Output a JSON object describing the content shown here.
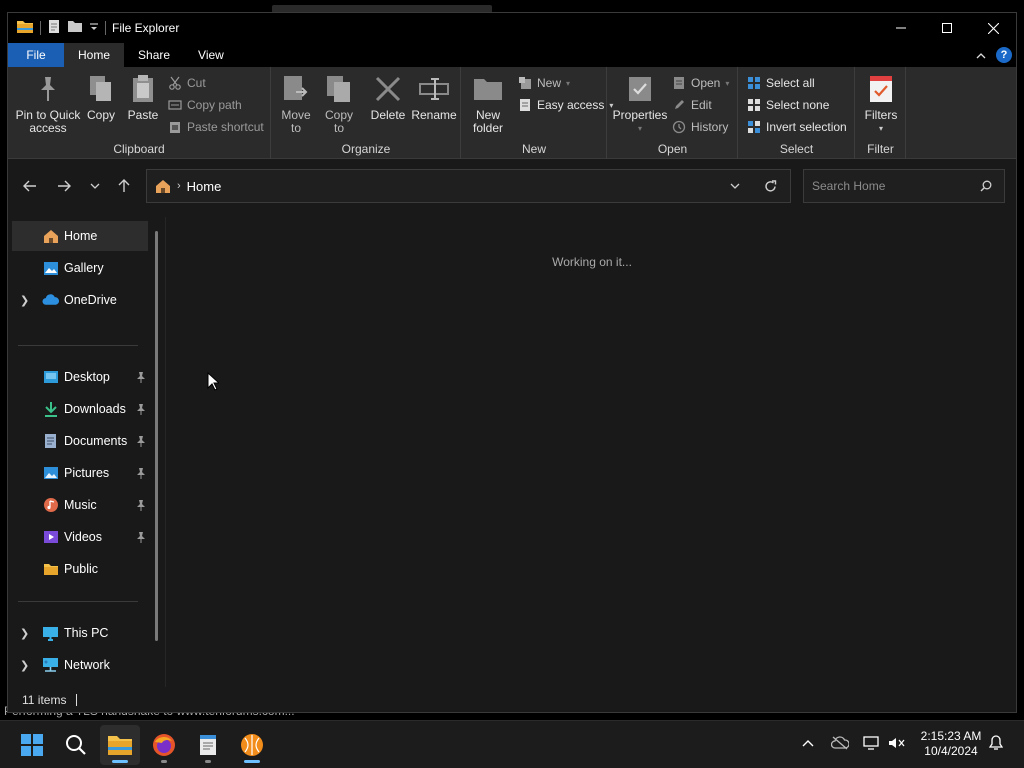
{
  "window": {
    "title": "File Explorer",
    "tabs": [
      "File",
      "Home",
      "Share",
      "View"
    ],
    "help": "?"
  },
  "ribbon": {
    "clipboard": {
      "label": "Clipboard",
      "pin": "Pin to Quick access",
      "copy": "Copy",
      "paste": "Paste",
      "cut": "Cut",
      "copy_path": "Copy path",
      "paste_shortcut": "Paste shortcut"
    },
    "organize": {
      "label": "Organize",
      "move_to": "Move to",
      "copy_to": "Copy to",
      "delete": "Delete",
      "rename": "Rename"
    },
    "new": {
      "label": "New",
      "new_folder": "New folder",
      "new_item": "New",
      "easy_access": "Easy access"
    },
    "open": {
      "label": "Open",
      "properties": "Properties",
      "open": "Open",
      "edit": "Edit",
      "history": "History"
    },
    "select": {
      "label": "Select",
      "select_all": "Select all",
      "select_none": "Select none",
      "invert": "Invert selection"
    },
    "filter": {
      "label": "Filter",
      "filters": "Filters"
    }
  },
  "address": {
    "crumb": "Home",
    "search_placeholder": "Search Home"
  },
  "nav": {
    "home": "Home",
    "gallery": "Gallery",
    "onedrive": "OneDrive",
    "desktop": "Desktop",
    "downloads": "Downloads",
    "documents": "Documents",
    "pictures": "Pictures",
    "music": "Music",
    "videos": "Videos",
    "public": "Public",
    "this_pc": "This PC",
    "network": "Network"
  },
  "content": {
    "message": "Working on it..."
  },
  "status": {
    "items": "11 items"
  },
  "desktop": {
    "background_text": "Performing a TLS handshake to www.tenforums.com..."
  },
  "taskbar": {
    "time": "2:15:23 AM",
    "date": "10/4/2024"
  },
  "colors": {
    "accent": "#1a5fb4",
    "window_bg": "#191919",
    "ribbon_bg": "#2b2b2b",
    "taskbar_bg": "#1c1c1c"
  }
}
